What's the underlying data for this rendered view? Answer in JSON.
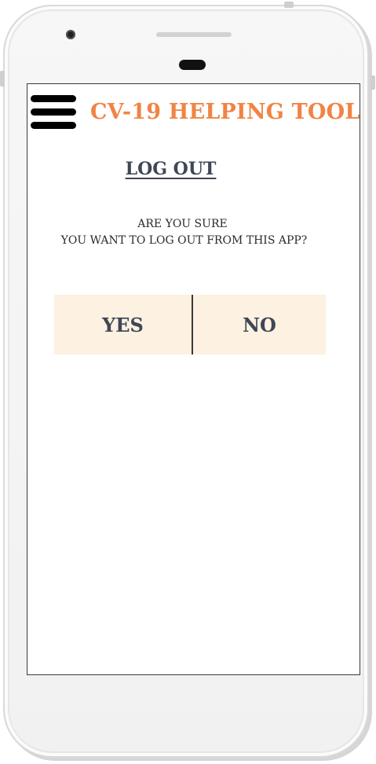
{
  "header": {
    "app_title": "CV-19 HELPING TOOL",
    "menu_icon": "hamburger-menu-icon"
  },
  "logout": {
    "page_title": "LOG OUT",
    "question_line1": "ARE YOU SURE",
    "question_line2": "YOU WANT TO LOG OUT FROM THIS APP?",
    "yes_label": "YES",
    "no_label": "NO"
  },
  "colors": {
    "accent": "#f08445",
    "button_background": "#fdf1e1",
    "text_dark": "#3f4656"
  }
}
